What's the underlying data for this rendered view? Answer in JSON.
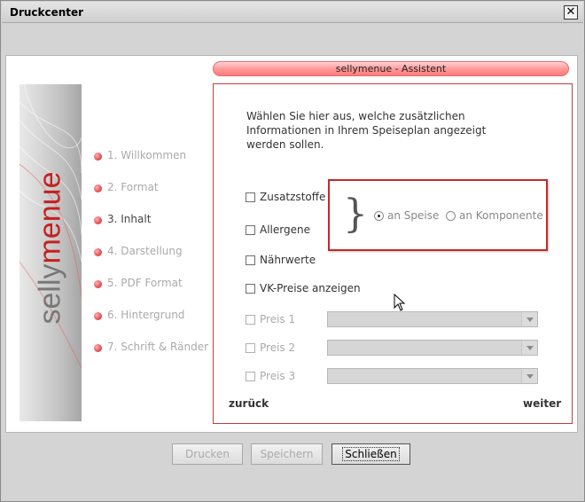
{
  "window": {
    "title": "Druckcenter",
    "close_symbol": "✕"
  },
  "header": {
    "title": "sellymenue - Assistent"
  },
  "brand": {
    "part1": "selly",
    "part2": "menue"
  },
  "steps": [
    {
      "label": "1. Willkommen"
    },
    {
      "label": "2. Format"
    },
    {
      "label": "3. Inhalt",
      "active": true
    },
    {
      "label": "4. Darstellung"
    },
    {
      "label": "5. PDF Format"
    },
    {
      "label": "6. Hintergrund"
    },
    {
      "label": "7. Schrift & Ränder"
    }
  ],
  "intro": {
    "line1": "Wählen Sie hier aus, welche zusätzlichen",
    "line2": "Informationen in Ihrem Speiseplan angezeigt",
    "line3": "werden sollen."
  },
  "options": {
    "zusatzstoffe": "Zusatzstoffe",
    "allergene": "Allergene",
    "naehrwerte": "Nährwerte",
    "vk_preise": "VK-Preise anzeigen",
    "preis1": "Preis 1",
    "preis2": "Preis 2",
    "preis3": "Preis 3"
  },
  "radio": {
    "an_speise": "an Speise",
    "an_komponente": "an Komponente",
    "selected": "an_speise"
  },
  "nav": {
    "back": "zurück",
    "next": "weiter"
  },
  "buttons": {
    "drucken": "Drucken",
    "speichern": "Speichern",
    "schliessen": "Schließen"
  },
  "colors": {
    "accent": "#c62828",
    "header_pill": "#ff8a8a"
  }
}
